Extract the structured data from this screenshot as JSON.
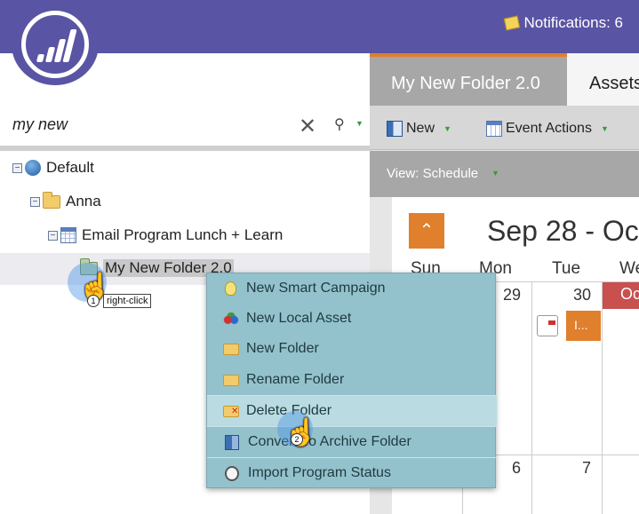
{
  "header": {
    "notifications_label": "Notifications: 6"
  },
  "search": {
    "value": "my new",
    "clear_icon": "close-icon",
    "filter_icon": "filter-icon"
  },
  "tree": {
    "items": [
      {
        "label": "Default",
        "icon": "globe-icon",
        "level": 0
      },
      {
        "label": "Anna",
        "icon": "folder-icon",
        "level": 1
      },
      {
        "label": "Email Program Lunch + Learn",
        "icon": "calendar-icon",
        "level": 2
      },
      {
        "label": "My New Folder 2.0",
        "icon": "folder-icon",
        "level": 3,
        "selected": true
      }
    ]
  },
  "annotations": {
    "step1_number": "1",
    "step1_label": "right-click",
    "step2_number": "2"
  },
  "context_menu": {
    "items": [
      {
        "label": "New Smart Campaign",
        "icon": "lightbulb-icon"
      },
      {
        "label": "New Local Asset",
        "icon": "local-asset-icon"
      },
      {
        "label": "New Folder",
        "icon": "folder-icon"
      },
      {
        "label": "Rename Folder",
        "icon": "folder-edit-icon"
      },
      {
        "label": "Delete Folder",
        "icon": "folder-delete-icon",
        "highlighted": true
      },
      {
        "label": "Convert To Archive Folder",
        "icon": "archive-icon"
      },
      {
        "label": "Import Program Status",
        "icon": "import-icon"
      }
    ]
  },
  "tabs": [
    {
      "label": "My New Folder 2.0",
      "active": true
    },
    {
      "label": "Assets",
      "active": false
    }
  ],
  "toolbar": {
    "new_label": "New",
    "event_actions_label": "Event Actions"
  },
  "view": {
    "label": "View: Schedule"
  },
  "calendar": {
    "title": "Sep 28 - Oc",
    "day_headers": [
      "Sun",
      "Mon",
      "Tue",
      "We"
    ],
    "row1_dates": [
      "29",
      "30",
      "Oc"
    ],
    "row2_dates": [
      "6",
      "7"
    ],
    "event_label": "I..."
  },
  "colors": {
    "header_bg": "#5a54a4",
    "accent_orange": "#e07f2c",
    "menu_bg": "#93c2cc",
    "menu_hover": "#b9dbe1",
    "october_red": "#c8504f"
  }
}
